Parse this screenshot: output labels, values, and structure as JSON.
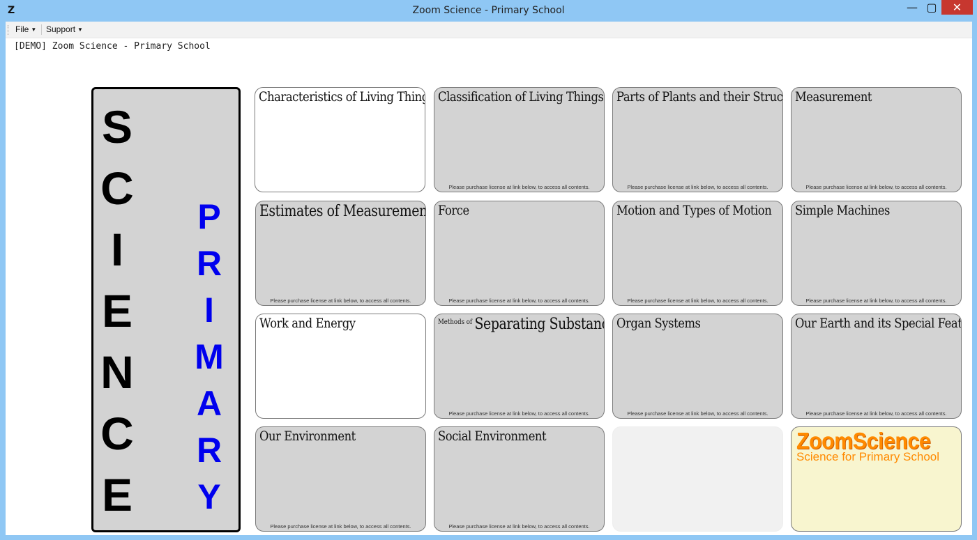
{
  "window": {
    "title": "Zoom Science - Primary School",
    "app_icon": "Z",
    "minimize": "—",
    "maximize": "▢",
    "close": "✕"
  },
  "menu": {
    "file": "File",
    "support": "Support"
  },
  "demo_label": "[DEMO] Zoom Science - Primary School",
  "side": {
    "science": [
      "S",
      "C",
      "I",
      "E",
      "N",
      "C",
      "E"
    ],
    "primary": [
      "P",
      "R",
      "I",
      "M",
      "A",
      "R",
      "Y"
    ]
  },
  "license_note": "Please purchase license at link below, to access all contents.",
  "tiles": [
    {
      "title": "Characteristics of Living Things",
      "note": ""
    },
    {
      "title": "Classification of Living Things",
      "note": "Please purchase license at link below, to access all contents."
    },
    {
      "title": "Parts of Plants and their Structure",
      "note": "Please purchase license at link below, to access all contents."
    },
    {
      "title": "Measurement",
      "note": "Please purchase license at link below, to access all contents."
    },
    {
      "title": "Estimates of Measurements",
      "note": "Please purchase license at link below, to access all contents."
    },
    {
      "title": "Force",
      "note": "Please purchase license at link below, to access all contents."
    },
    {
      "title": "Motion and Types of Motion",
      "note": "Please purchase license at link below, to access all contents."
    },
    {
      "title": "Simple Machines",
      "note": "Please purchase license at link below, to access all contents."
    },
    {
      "title": "Work and Energy",
      "note": ""
    },
    {
      "prefix": "Methods of",
      "title": "Separating Substances",
      "note": "Please purchase license at link below, to access all contents."
    },
    {
      "title": "Organ Systems",
      "note": "Please purchase license at link below, to access all contents."
    },
    {
      "title": "Our Earth and its Special Features",
      "note": "Please purchase license at link below, to access all contents."
    },
    {
      "title": "Our Environment",
      "note": "Please purchase license at link below, to access all contents."
    },
    {
      "title": "Social Environment",
      "note": "Please purchase license at link below, to access all contents."
    }
  ],
  "logo": {
    "name": "ZoomScience",
    "tagline": "Science for Primary School"
  }
}
